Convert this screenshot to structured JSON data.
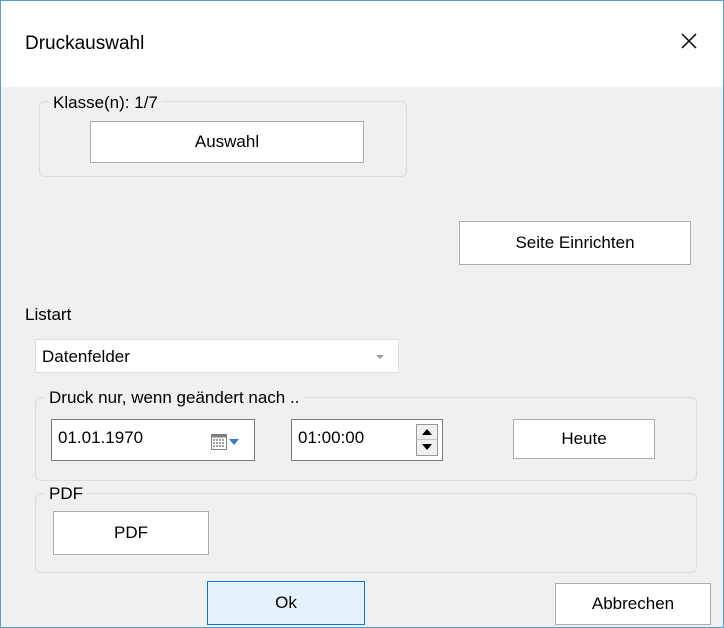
{
  "window": {
    "title": "Druckauswahl",
    "close_icon": "close-icon"
  },
  "class_group": {
    "legend": "Klasse(n): 1/7",
    "select_button": "Auswahl"
  },
  "page_setup_button": "Seite Einrichten",
  "list_type": {
    "label": "Listart",
    "selected": "Datenfelder"
  },
  "changed_after_group": {
    "legend": "Druck nur, wenn geändert nach ..",
    "date_value": "01.01.1970",
    "time_value": "01:00:00",
    "today_button": "Heute",
    "calendar_icon": "calendar-icon"
  },
  "pdf_group": {
    "legend": "PDF",
    "pdf_button": "PDF"
  },
  "footer": {
    "ok_button": "Ok",
    "cancel_button": "Abbrechen"
  },
  "colors": {
    "accent": "#0078d7",
    "window_border": "#5a9bd4",
    "background": "#f0f0f0"
  }
}
